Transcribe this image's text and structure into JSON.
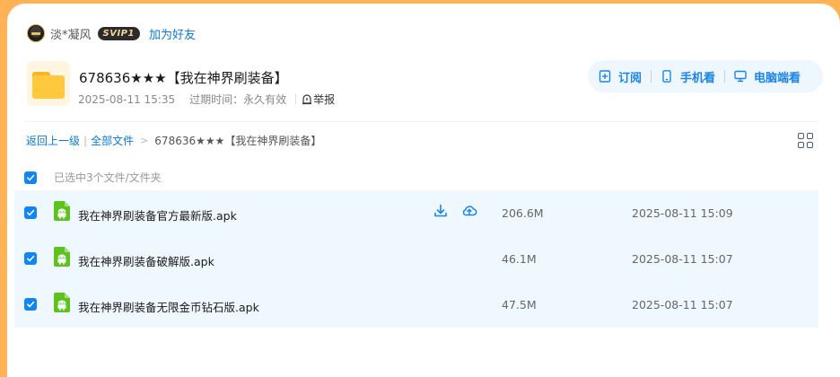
{
  "user": {
    "name": "淡*凝风",
    "vip_badge": "SVIP1",
    "add_friend_label": "加为好友"
  },
  "share": {
    "title": "678636★★★【我在神界刷装备】",
    "created_at": "2025-08-11 15:35",
    "expire_label": "过期时间：永久有效",
    "report_label": "举报"
  },
  "actions": {
    "subscribe_label": "订阅",
    "mobile_label": "手机看",
    "pc_label": "电脑端看"
  },
  "breadcrumb": {
    "back_label": "返回上一级",
    "all_files_label": "全部文件",
    "current": "678636★★★【我在神界刷装备】"
  },
  "selection": {
    "summary": "已选中3个文件/文件夹"
  },
  "files": [
    {
      "name": "我在神界刷装备官方最新版.apk",
      "size": "206.6M",
      "date": "2025-08-11 15:09",
      "checked": true
    },
    {
      "name": "我在神界刷装备破解版.apk",
      "size": "46.1M",
      "date": "2025-08-11 15:07",
      "checked": true
    },
    {
      "name": "我在神界刷装备无限金币钻石版.apk",
      "size": "47.5M",
      "date": "2025-08-11 15:07",
      "checked": true
    }
  ],
  "colors": {
    "accent": "#0f86f0",
    "link": "#0b79d6",
    "row_selected_bg": "#f0f8ff",
    "page_border": "#ffb356",
    "apk_green": "#5dc21e"
  },
  "icons": {
    "report": "report-icon",
    "subscribe": "subscribe-icon",
    "mobile": "mobile-icon",
    "pc": "monitor-icon",
    "download": "download-icon",
    "save_to_cloud": "cloud-upload-icon",
    "view_toggle": "grid-view-icon",
    "file_type": "android-apk-icon"
  }
}
